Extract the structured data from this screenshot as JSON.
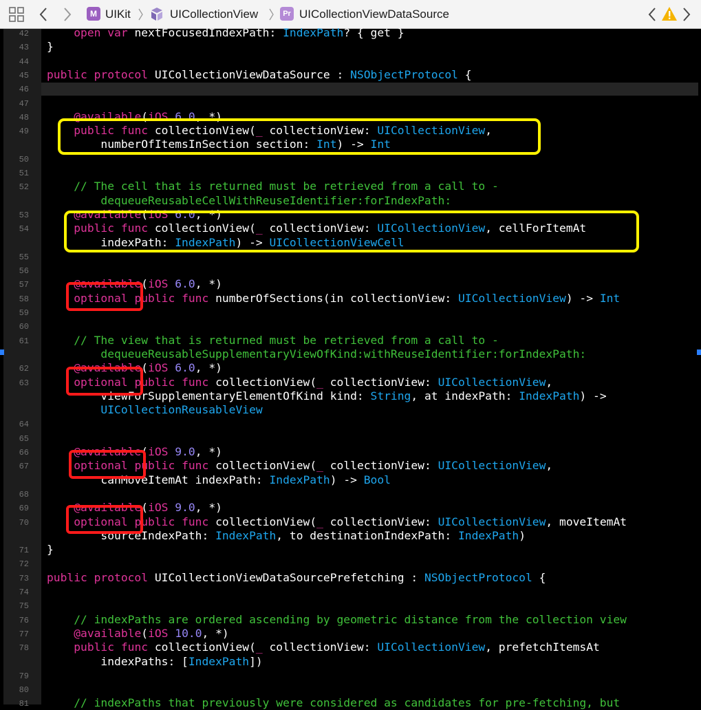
{
  "breadcrumb": {
    "items": [
      {
        "label": "UIKit",
        "icon_letter": "M",
        "icon_color": "#9b5fc0"
      },
      {
        "label": "UICollectionView",
        "icon_color": "#9b86c9"
      },
      {
        "label": "UICollectionViewDataSource",
        "icon_letter": "Pr",
        "icon_color": "#b48ad6"
      }
    ]
  },
  "icons": {
    "grid": "grid-icon",
    "back": "back-chevron-icon",
    "forward": "forward-chevron-icon",
    "warning": "warning-icon"
  },
  "colors": {
    "keyword": "#e0349a",
    "type": "#1ea7ef",
    "number": "#9686f5",
    "comment": "#40c13a",
    "highlight_yellow": "#fff200",
    "highlight_red": "#ff1a1a",
    "warning": "#f5b400"
  },
  "current_line": 46,
  "code_lines": [
    {
      "n": 42,
      "segs": [
        [
          "    ",
          ""
        ],
        [
          "open var",
          "kw"
        ],
        [
          " nextFocusedIndexPath: ",
          ""
        ],
        [
          "IndexPath",
          "ty"
        ],
        [
          "? { get }",
          ""
        ]
      ]
    },
    {
      "n": 43,
      "segs": [
        [
          "}",
          ""
        ]
      ]
    },
    {
      "n": 44,
      "segs": []
    },
    {
      "n": 45,
      "segs": [
        [
          "public protocol",
          "kw"
        ],
        [
          " UICollectionViewDataSource : ",
          ""
        ],
        [
          "NSObjectProtocol",
          "ty"
        ],
        [
          " {",
          ""
        ]
      ]
    },
    {
      "n": 46,
      "segs": []
    },
    {
      "n": 47,
      "segs": []
    },
    {
      "n": 48,
      "segs": [
        [
          "    ",
          ""
        ],
        [
          "@available",
          "kw"
        ],
        [
          "(",
          ""
        ],
        [
          "iOS",
          "kw"
        ],
        [
          " ",
          ""
        ],
        [
          "6.0",
          "num"
        ],
        [
          ", *)",
          ""
        ]
      ]
    },
    {
      "n": 49,
      "segs": [
        [
          "    ",
          ""
        ],
        [
          "public func",
          "kw"
        ],
        [
          " collectionView(",
          ""
        ],
        [
          "_",
          "kw"
        ],
        [
          " collectionView: ",
          ""
        ],
        [
          "UICollectionView",
          "ty"
        ],
        [
          ",",
          ""
        ]
      ]
    },
    {
      "n": null,
      "segs": [
        [
          "        numberOfItemsInSection section: ",
          ""
        ],
        [
          "Int",
          "ty"
        ],
        [
          ") -> ",
          ""
        ],
        [
          "Int",
          "ty"
        ]
      ]
    },
    {
      "n": 50,
      "segs": []
    },
    {
      "n": 51,
      "segs": []
    },
    {
      "n": 52,
      "segs": [
        [
          "    // The cell that is returned must be retrieved from a call to -",
          "cm"
        ]
      ]
    },
    {
      "n": null,
      "segs": [
        [
          "        dequeueReusableCellWithReuseIdentifier:forIndexPath:",
          "cm"
        ]
      ]
    },
    {
      "n": 53,
      "segs": [
        [
          "    ",
          ""
        ],
        [
          "@available",
          "kw"
        ],
        [
          "(",
          ""
        ],
        [
          "iOS",
          "kw"
        ],
        [
          " ",
          ""
        ],
        [
          "6.0",
          "num"
        ],
        [
          ", *)",
          ""
        ]
      ]
    },
    {
      "n": 54,
      "segs": [
        [
          "    ",
          ""
        ],
        [
          "public func",
          "kw"
        ],
        [
          " collectionView(",
          ""
        ],
        [
          "_",
          "kw"
        ],
        [
          " collectionView: ",
          ""
        ],
        [
          "UICollectionView",
          "ty"
        ],
        [
          ", cellForItemAt",
          ""
        ]
      ]
    },
    {
      "n": null,
      "segs": [
        [
          "        indexPath: ",
          ""
        ],
        [
          "IndexPath",
          "ty"
        ],
        [
          ") -> ",
          ""
        ],
        [
          "UICollectionViewCell",
          "ty"
        ]
      ]
    },
    {
      "n": 55,
      "segs": []
    },
    {
      "n": 56,
      "segs": []
    },
    {
      "n": 57,
      "segs": [
        [
          "    ",
          ""
        ],
        [
          "@available",
          "kw"
        ],
        [
          "(",
          ""
        ],
        [
          "iOS",
          "kw"
        ],
        [
          " ",
          ""
        ],
        [
          "6.0",
          "num"
        ],
        [
          ", *)",
          ""
        ]
      ]
    },
    {
      "n": 58,
      "segs": [
        [
          "    ",
          ""
        ],
        [
          "optional",
          "kw"
        ],
        [
          " ",
          ""
        ],
        [
          "public func",
          "kw"
        ],
        [
          " numberOfSections(in collectionView: ",
          ""
        ],
        [
          "UICollectionView",
          "ty"
        ],
        [
          ") -> ",
          ""
        ],
        [
          "Int",
          "ty"
        ]
      ]
    },
    {
      "n": 59,
      "segs": []
    },
    {
      "n": 60,
      "segs": []
    },
    {
      "n": 61,
      "segs": [
        [
          "    // The view that is returned must be retrieved from a call to -",
          "cm"
        ]
      ]
    },
    {
      "n": null,
      "segs": [
        [
          "        dequeueReusableSupplementaryViewOfKind:withReuseIdentifier:forIndexPath:",
          "cm"
        ]
      ]
    },
    {
      "n": 62,
      "segs": [
        [
          "    ",
          ""
        ],
        [
          "@available",
          "kw"
        ],
        [
          "(",
          ""
        ],
        [
          "iOS",
          "kw"
        ],
        [
          " ",
          ""
        ],
        [
          "6.0",
          "num"
        ],
        [
          ", *)",
          ""
        ]
      ]
    },
    {
      "n": 63,
      "segs": [
        [
          "    ",
          ""
        ],
        [
          "optional",
          "kw"
        ],
        [
          " ",
          ""
        ],
        [
          "public func",
          "kw"
        ],
        [
          " collectionView(",
          ""
        ],
        [
          "_",
          "kw"
        ],
        [
          " collectionView: ",
          ""
        ],
        [
          "UICollectionView",
          "ty"
        ],
        [
          ",",
          ""
        ]
      ]
    },
    {
      "n": null,
      "segs": [
        [
          "        viewForSupplementaryElementOfKind kind: ",
          ""
        ],
        [
          "String",
          "ty"
        ],
        [
          ", at indexPath: ",
          ""
        ],
        [
          "IndexPath",
          "ty"
        ],
        [
          ") ->",
          ""
        ]
      ]
    },
    {
      "n": null,
      "segs": [
        [
          "        ",
          ""
        ],
        [
          "UICollectionReusableView",
          "ty"
        ]
      ]
    },
    {
      "n": 64,
      "segs": []
    },
    {
      "n": 65,
      "segs": []
    },
    {
      "n": 66,
      "segs": [
        [
          "    ",
          ""
        ],
        [
          "@available",
          "kw"
        ],
        [
          "(",
          ""
        ],
        [
          "iOS",
          "kw"
        ],
        [
          " ",
          ""
        ],
        [
          "9.0",
          "num"
        ],
        [
          ", *)",
          ""
        ]
      ]
    },
    {
      "n": 67,
      "segs": [
        [
          "    ",
          ""
        ],
        [
          "optional",
          "kw"
        ],
        [
          " ",
          ""
        ],
        [
          "public func",
          "kw"
        ],
        [
          " collectionView(",
          ""
        ],
        [
          "_",
          "kw"
        ],
        [
          " collectionView: ",
          ""
        ],
        [
          "UICollectionView",
          "ty"
        ],
        [
          ",",
          ""
        ]
      ]
    },
    {
      "n": null,
      "segs": [
        [
          "        canMoveItemAt indexPath: ",
          ""
        ],
        [
          "IndexPath",
          "ty"
        ],
        [
          ") -> ",
          ""
        ],
        [
          "Bool",
          "ty"
        ]
      ]
    },
    {
      "n": 68,
      "segs": []
    },
    {
      "n": 69,
      "segs": [
        [
          "    ",
          ""
        ],
        [
          "@available",
          "kw"
        ],
        [
          "(",
          ""
        ],
        [
          "iOS",
          "kw"
        ],
        [
          " ",
          ""
        ],
        [
          "9.0",
          "num"
        ],
        [
          ", *)",
          ""
        ]
      ]
    },
    {
      "n": 70,
      "segs": [
        [
          "    ",
          ""
        ],
        [
          "optional",
          "kw"
        ],
        [
          " ",
          ""
        ],
        [
          "public func",
          "kw"
        ],
        [
          " collectionView(",
          ""
        ],
        [
          "_",
          "kw"
        ],
        [
          " collectionView: ",
          ""
        ],
        [
          "UICollectionView",
          "ty"
        ],
        [
          ", moveItemAt",
          ""
        ]
      ]
    },
    {
      "n": null,
      "segs": [
        [
          "        sourceIndexPath: ",
          ""
        ],
        [
          "IndexPath",
          "ty"
        ],
        [
          ", to destinationIndexPath: ",
          ""
        ],
        [
          "IndexPath",
          "ty"
        ],
        [
          ")",
          ""
        ]
      ]
    },
    {
      "n": 71,
      "segs": [
        [
          "}",
          ""
        ]
      ]
    },
    {
      "n": 72,
      "segs": []
    },
    {
      "n": 73,
      "segs": [
        [
          "public protocol",
          "kw"
        ],
        [
          " UICollectionViewDataSourcePrefetching : ",
          ""
        ],
        [
          "NSObjectProtocol",
          "ty"
        ],
        [
          " {",
          ""
        ]
      ]
    },
    {
      "n": 74,
      "segs": []
    },
    {
      "n": 75,
      "segs": []
    },
    {
      "n": 76,
      "segs": [
        [
          "    // indexPaths are ordered ascending by geometric distance from the collection view",
          "cm"
        ]
      ]
    },
    {
      "n": 77,
      "segs": [
        [
          "    ",
          ""
        ],
        [
          "@available",
          "kw"
        ],
        [
          "(",
          ""
        ],
        [
          "iOS",
          "kw"
        ],
        [
          " ",
          ""
        ],
        [
          "10.0",
          "num"
        ],
        [
          ", *)",
          ""
        ]
      ]
    },
    {
      "n": 78,
      "segs": [
        [
          "    ",
          ""
        ],
        [
          "public func",
          "kw"
        ],
        [
          " collectionView(",
          ""
        ],
        [
          "_",
          "kw"
        ],
        [
          " collectionView: ",
          ""
        ],
        [
          "UICollectionView",
          "ty"
        ],
        [
          ", prefetchItemsAt",
          ""
        ]
      ]
    },
    {
      "n": null,
      "segs": [
        [
          "        indexPaths: [",
          ""
        ],
        [
          "IndexPath",
          "ty"
        ],
        [
          "])",
          ""
        ]
      ]
    },
    {
      "n": 79,
      "segs": []
    },
    {
      "n": 80,
      "segs": []
    },
    {
      "n": 81,
      "segs": [
        [
          "    // indexPaths that previously were considered as candidates for pre-fetching, but",
          "cm"
        ]
      ]
    }
  ]
}
